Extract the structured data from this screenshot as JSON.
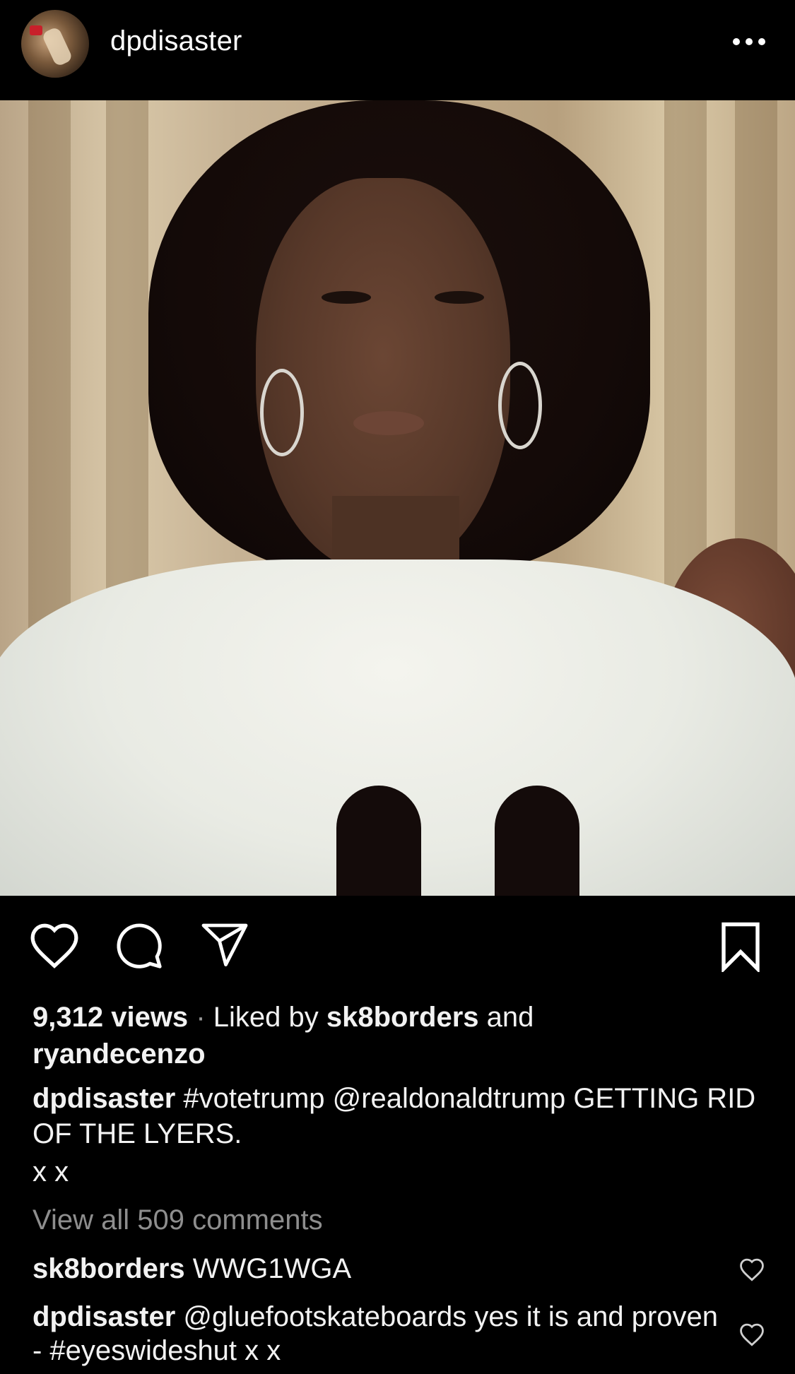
{
  "post": {
    "username": "dpdisaster",
    "more_icon": "more-horizontal-icon"
  },
  "engagement": {
    "views": "9,312 views",
    "separator": "·",
    "liked_by_prefix": "Liked by",
    "liker1": "sk8borders",
    "and_text": "and",
    "liker2": "ryandecenzo"
  },
  "caption": {
    "username": "dpdisaster",
    "text": "#votetrump @realdonaldtrump  GETTING RID OF THE LYERS.",
    "text2": "x x"
  },
  "comments": {
    "view_all": "View all 509 comments",
    "items": [
      {
        "username": "sk8borders",
        "text": "WWG1WGA"
      },
      {
        "username": "dpdisaster",
        "text": "@gluefootskateboards yes it is and proven - #eyeswideshut x x"
      }
    ]
  },
  "icons": {
    "like": "heart-icon",
    "comment": "comment-icon",
    "share": "share-icon",
    "save": "bookmark-icon"
  }
}
